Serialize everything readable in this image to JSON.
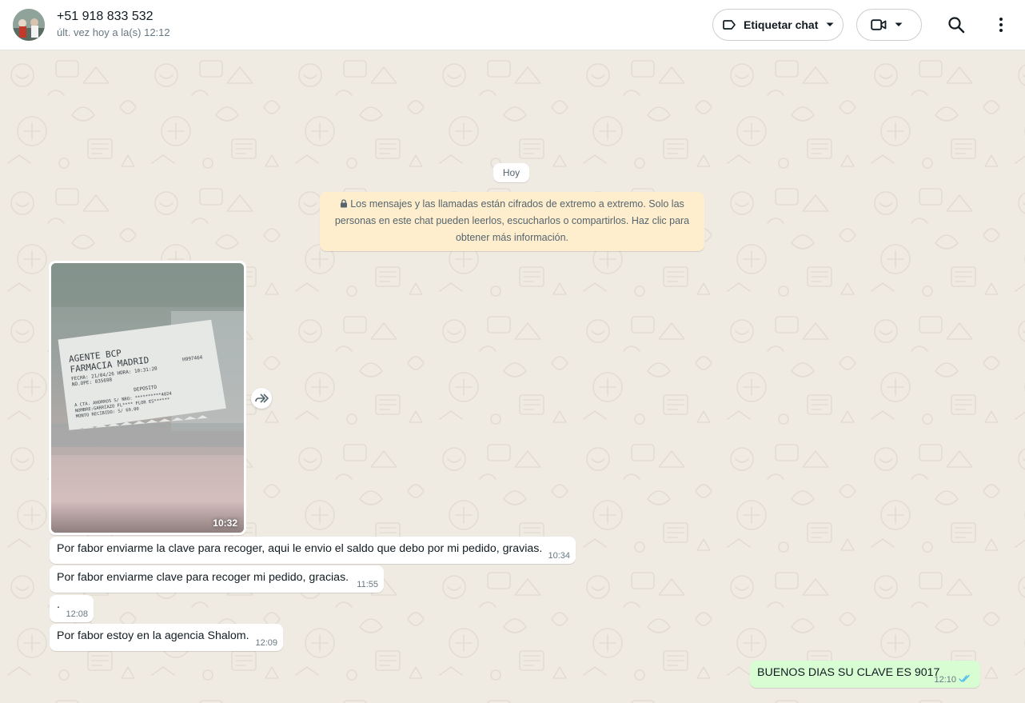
{
  "header": {
    "contact_name": "+51 918 833 532",
    "contact_status": "últ. vez hoy a la(s) 12:12",
    "label_button": "Etiquetar chat",
    "icons": [
      "label-icon",
      "caret-down-icon",
      "video-icon",
      "search-icon",
      "menu-dots-icon"
    ]
  },
  "chat": {
    "date_chip": "Hoy",
    "encryption_notice": "Los mensajes y las llamadas están cifrados de extremo a extremo. Solo las personas en este chat pueden leerlos, escucharlos o compartirlos. Haz clic para obtener más información.",
    "image_message": {
      "time": "10:32",
      "receipt_lines": [
        "AGENTE BCP",
        "FARMACIA MADRID",
        "FECHA: 21/04/26 HORA: 10:31:20",
        "H997464",
        "NO.OPE: 035698",
        "DEPOSITO",
        "A CTA. AHORROS S/  NRO: **********4024",
        "NOMBRE:GARRIAZO FL**** FLOR ES******",
        "MONTO RECIBIDO:      S/      69.00"
      ]
    },
    "messages": [
      {
        "direction": "in",
        "text": "Por fabor enviarme la clave para recoger, aqui le envio el saldo que debo por mi pedido, gravias.",
        "time": "10:34"
      },
      {
        "direction": "in",
        "text": "Por fabor enviarme clave para recoger mi pedido, gracias.",
        "time": "11:55"
      },
      {
        "direction": "in",
        "text": ".",
        "time": "12:08"
      },
      {
        "direction": "in",
        "text": "Por fabor estoy en la agencia Shalom.",
        "time": "12:09"
      },
      {
        "direction": "out",
        "text": "BUENOS DIAS SU CLAVE ES 9017",
        "time": "12:10",
        "status": "read"
      }
    ]
  },
  "colors": {
    "background": "#efeae2",
    "incoming_bubble": "#ffffff",
    "outgoing_bubble": "#d9fdd3",
    "notice_bubble": "#ffeecd",
    "read_ticks": "#53bdeb"
  }
}
